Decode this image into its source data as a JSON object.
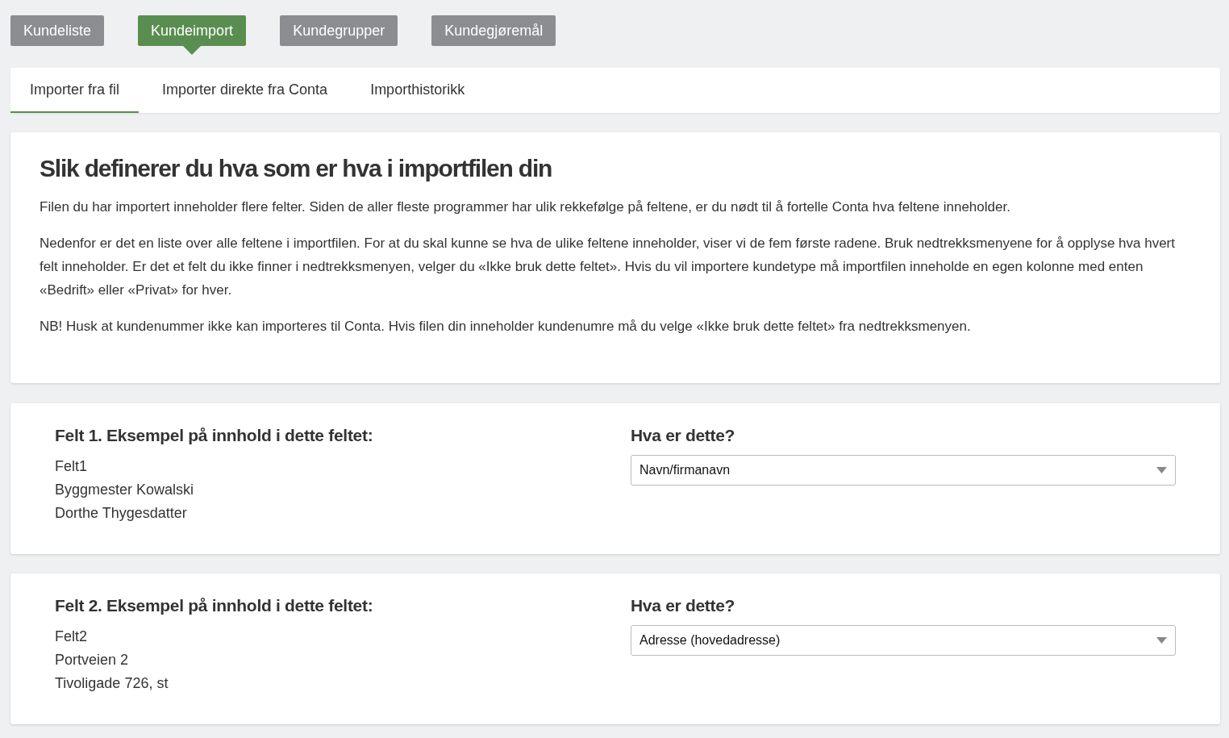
{
  "nav_buttons": [
    {
      "label": "Kundeliste",
      "selected": false
    },
    {
      "label": "Kundeimport",
      "selected": true
    },
    {
      "label": "Kundegrupper",
      "selected": false
    },
    {
      "label": "Kundegjøremål",
      "selected": false
    }
  ],
  "tabs": [
    {
      "label": "Importer fra fil",
      "selected": true
    },
    {
      "label": "Importer direkte fra Conta",
      "selected": false
    },
    {
      "label": "Importhistorikk",
      "selected": false
    }
  ],
  "intro": {
    "title": "Slik definerer du hva som er hva i importfilen din",
    "paragraphs": [
      "Filen du har importert inneholder flere felter. Siden de aller fleste programmer har ulik rekkefølge på feltene, er du nødt til å fortelle Conta hva feltene inneholder.",
      "Nedenfor er det en liste over alle feltene i importfilen. For at du skal kunne se hva de ulike feltene inneholder, viser vi de fem første radene. Bruk nedtrekksmenyene for å opplyse hva hvert felt inneholder. Er det et felt du ikke finner i nedtrekksmenyen, velger du «Ikke bruk dette feltet». Hvis du vil importere kundetype må importfilen inneholde en egen kolonne med enten «Bedrift» eller «Privat» for hver.",
      "NB! Husk at kundenummer ikke kan importeres til Conta. Hvis filen din inneholder kundenumre må du velge «Ikke bruk dette feltet» fra nedtrekksmenyen."
    ]
  },
  "fields": [
    {
      "heading": "Felt 1. Eksempel på innhold i dette feltet:",
      "examples": [
        "Felt1",
        "Byggmester Kowalski",
        "Dorthe Thygesdatter"
      ],
      "question": "Hva er dette?",
      "value": "Navn/firmanavn"
    },
    {
      "heading": "Felt 2. Eksempel på innhold i dette feltet:",
      "examples": [
        "Felt2",
        "Portveien 2",
        "Tivoligade 726, st"
      ],
      "question": "Hva er dette?",
      "value": "Adresse (hovedadresse)"
    }
  ]
}
